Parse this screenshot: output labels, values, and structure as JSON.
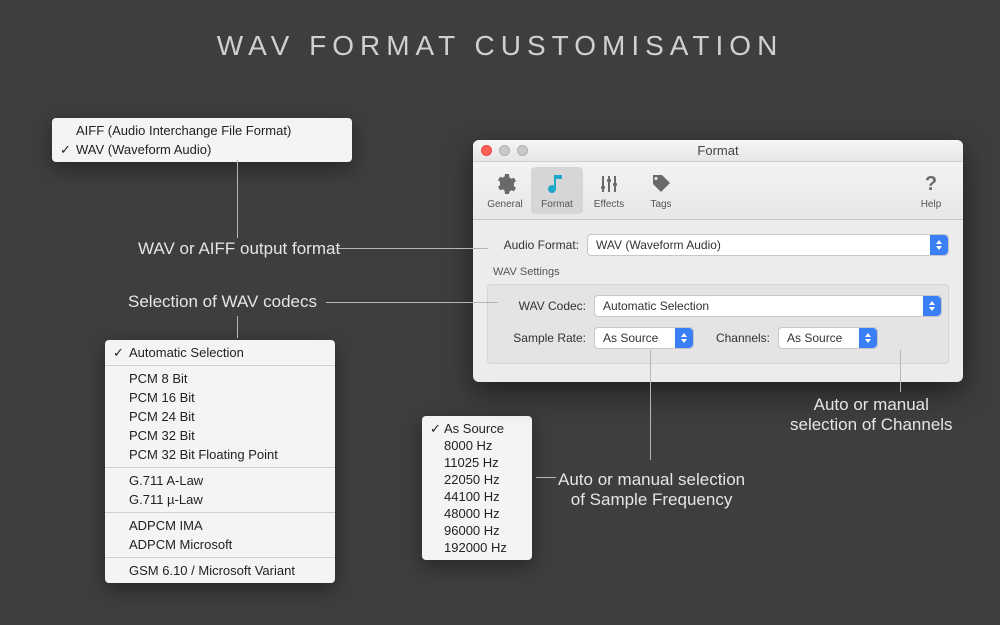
{
  "page_title": "WAV  FORMAT  CUSTOMISATION",
  "annotations": {
    "output_format": "WAV or AIFF output format",
    "codecs": "Selection of WAV codecs",
    "sample": "Auto or manual selection\nof Sample Frequency",
    "channels": "Auto or manual\nselection of Channels"
  },
  "format_menu": {
    "items": [
      {
        "label": "AIFF (Audio Interchange File Format)",
        "checked": false
      },
      {
        "label": "WAV (Waveform Audio)",
        "checked": true
      }
    ]
  },
  "codec_menu": {
    "groups": [
      [
        {
          "label": "Automatic Selection",
          "checked": true
        }
      ],
      [
        {
          "label": "PCM 8 Bit"
        },
        {
          "label": "PCM 16 Bit"
        },
        {
          "label": "PCM 24 Bit"
        },
        {
          "label": "PCM 32 Bit"
        },
        {
          "label": "PCM 32 Bit Floating Point"
        }
      ],
      [
        {
          "label": "G.711 A-Law"
        },
        {
          "label": "G.711 µ-Law"
        }
      ],
      [
        {
          "label": "ADPCM IMA"
        },
        {
          "label": "ADPCM Microsoft"
        }
      ],
      [
        {
          "label": "GSM 6.10 / Microsoft Variant"
        }
      ]
    ]
  },
  "rate_menu": {
    "items": [
      {
        "label": "As Source",
        "checked": true
      },
      {
        "label": "8000 Hz"
      },
      {
        "label": "11025 Hz"
      },
      {
        "label": "22050 Hz"
      },
      {
        "label": "44100 Hz"
      },
      {
        "label": "48000 Hz"
      },
      {
        "label": "96000 Hz"
      },
      {
        "label": "192000 Hz"
      }
    ]
  },
  "window": {
    "title": "Format",
    "toolbar": {
      "general": "General",
      "format": "Format",
      "effects": "Effects",
      "tags": "Tags",
      "help": "Help"
    },
    "labels": {
      "audio_format": "Audio Format:",
      "wav_settings": "WAV Settings",
      "wav_codec": "WAV Codec:",
      "sample_rate": "Sample Rate:",
      "channels": "Channels:"
    },
    "values": {
      "audio_format": "WAV (Waveform Audio)",
      "wav_codec": "Automatic Selection",
      "sample_rate": "As Source",
      "channels": "As Source"
    }
  }
}
